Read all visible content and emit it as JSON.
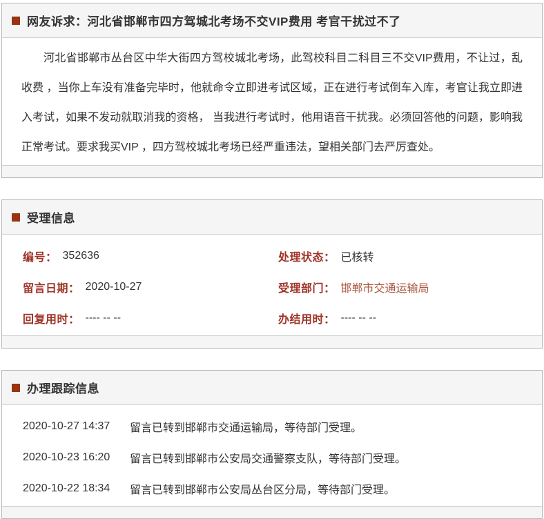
{
  "colors": {
    "accent": "#9a3312",
    "label": "#9e3326",
    "link": "#a9573f",
    "header_bg": "#f5f5f5",
    "border": "#b5b5b5",
    "text": "#333333"
  },
  "complaint": {
    "section_title": "网友诉求：河北省邯郸市四方驾城北考场不交VIP费用 考官干扰过不了",
    "body": "河北省邯郸市丛台区中华大街四方驾校城北考场，此驾校科目二科目三不交VIP费用，不让过，乱收费 ，当你上车没有准备完毕时，他就命令立即进考试区域，正在进行考试倒车入库，考官让我立即进入考试，如果不发动就取消我的资格， 当我进行考试时，他用语音干扰我。必须回答他的问题，影响我正常考试。要求我买VIP ，四方驾校城北考场已经严重违法，望相关部门去严厉查处。"
  },
  "acceptance": {
    "section_title": "受理信息",
    "fields": [
      {
        "label": "编号：",
        "value": "352636"
      },
      {
        "label": "处理状态：",
        "value": "已核转"
      },
      {
        "label": "留言日期：",
        "value": "2020-10-27"
      },
      {
        "label": "受理部门：",
        "value": "邯郸市交通运输局"
      },
      {
        "label": "回复用时：",
        "value": "---- -- --"
      },
      {
        "label": "办结用时：",
        "value": "---- -- --"
      }
    ]
  },
  "tracking": {
    "section_title": "办理跟踪信息",
    "entries": [
      {
        "datetime": "2020-10-27 14:37",
        "message": "留言已转到邯郸市交通运输局，等待部门受理。"
      },
      {
        "datetime": "2020-10-23 16:20",
        "message": "留言已转到邯郸市公安局交通警察支队，等待部门受理。"
      },
      {
        "datetime": "2020-10-22 18:34",
        "message": "留言已转到邯郸市公安局丛台区分局，等待部门受理。"
      }
    ]
  }
}
